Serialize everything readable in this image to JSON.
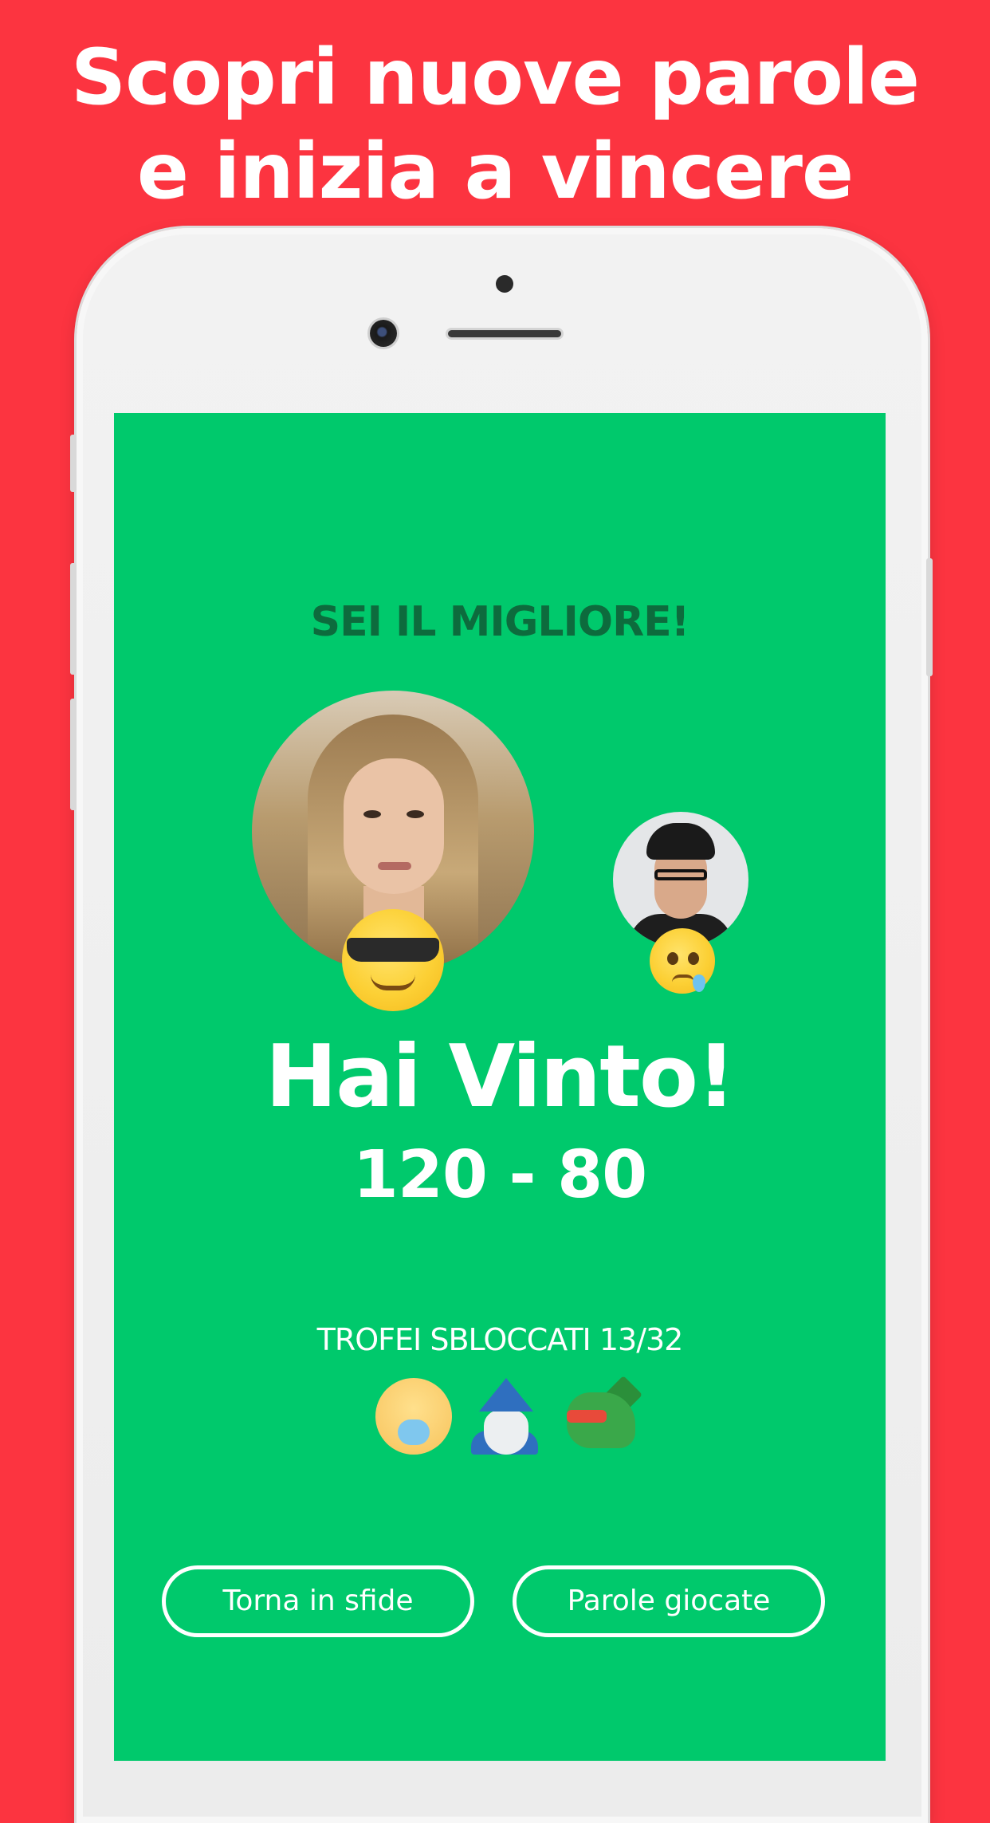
{
  "headline": {
    "line1": "Scopri nuove parole",
    "line2": "e inizia a vincere"
  },
  "result_screen": {
    "banner": "SEI IL MIGLIORE!",
    "title": "Hai Vinto!",
    "score": "120 - 80",
    "trophies_label": "TROFEI SBLOCCATI 13/32",
    "trophies": [
      "baby-icon",
      "wizard-icon",
      "dragon-icon"
    ],
    "buttons": {
      "back": "Torna in sfide",
      "words": "Parole giocate"
    }
  },
  "colors": {
    "background": "#fc3440",
    "screen": "#00c96c",
    "banner_text": "#0d6b3d"
  }
}
